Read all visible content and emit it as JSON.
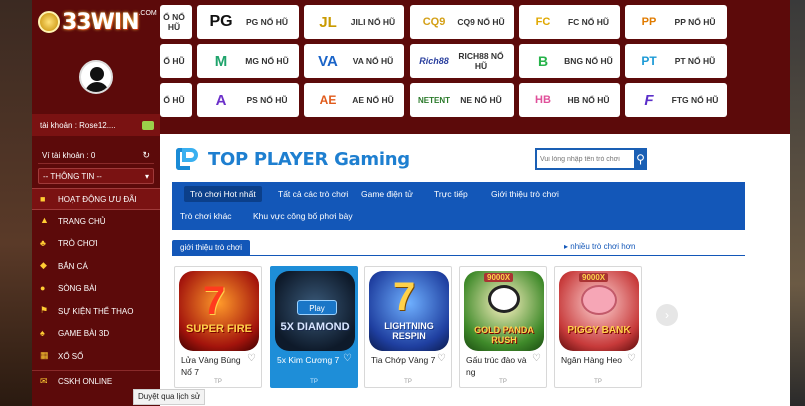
{
  "brand": {
    "logo_text": "33WIN",
    "logo_com": ".COM"
  },
  "sidebar": {
    "account_label": "tài khoản : Rose12....",
    "wallet_label": "Ví tài khoản : 0",
    "info_select": "-- THÔNG TIN --",
    "menu": [
      {
        "label": "HOẠT ĐỘNG ƯU ĐÃI",
        "icon": "gift-icon"
      },
      {
        "label": "TRANG CHỦ",
        "icon": "home-icon"
      },
      {
        "label": "TRÒ CHƠI",
        "icon": "games-icon"
      },
      {
        "label": "BẮN CÁ",
        "icon": "fish-icon"
      },
      {
        "label": "SÒNG BÀI",
        "icon": "casino-icon"
      },
      {
        "label": "SỰ KIỆN THỂ THAO",
        "icon": "sports-icon"
      },
      {
        "label": "GAME BÀI 3D",
        "icon": "cards-icon"
      },
      {
        "label": "XỔ SỐ",
        "icon": "lottery-icon"
      },
      {
        "label": "CSKH ONLINE",
        "icon": "chat-icon"
      }
    ]
  },
  "providers": [
    {
      "name": "Ổ NỔ HŨ",
      "logo": ""
    },
    {
      "name": "PG NỔ HŨ",
      "logo": "PG"
    },
    {
      "name": "JILI NỔ HŨ",
      "logo": "JL"
    },
    {
      "name": "CQ9 NỔ HŨ",
      "logo": "CQ9"
    },
    {
      "name": "FC NỔ HŨ",
      "logo": "FC"
    },
    {
      "name": "PP NỔ HŨ",
      "logo": "PP"
    },
    {
      "name": "Ổ HŨ",
      "logo": ""
    },
    {
      "name": "MG NỔ HŨ",
      "logo": "M"
    },
    {
      "name": "VA NỔ HŨ",
      "logo": "VA"
    },
    {
      "name": "RICH88 NỔ HŨ",
      "logo": "Rich88"
    },
    {
      "name": "BNG NỔ HŨ",
      "logo": "B"
    },
    {
      "name": "PT NỔ HŨ",
      "logo": "PT"
    },
    {
      "name": "Ổ HŨ",
      "logo": ""
    },
    {
      "name": "PS NỔ HŨ",
      "logo": "A"
    },
    {
      "name": "AE NỔ HŨ",
      "logo": "AE"
    },
    {
      "name": "NE NỔ HŨ",
      "logo": "NETENT"
    },
    {
      "name": "HB NỔ HŨ",
      "logo": "HB"
    },
    {
      "name": "FTG NỔ HŨ",
      "logo": "F"
    }
  ],
  "content": {
    "brand_title": "TOP PLAYER Gaming",
    "search_placeholder": "Vui lòng nhập tên trò chơi",
    "nav": [
      "Trò chơi Hot nhất",
      "Tất cả các trò chơi",
      "Game điện tử",
      "Trực tiếp",
      "Giới thiệu trò chơi",
      "Trò chơi khác",
      "Khu vực công bố phơi bày"
    ],
    "section_tab": "giới thiệu trò chơi",
    "more_link": "nhiều trò chơi hơn",
    "games": [
      {
        "name": "Lửa Vàng Bùng Nổ 7",
        "title": "SUPER FIRE",
        "tp": "TP"
      },
      {
        "name": "5x Kim Cương 7",
        "title": "5X DIAMOND",
        "tp": "TP",
        "play": "Play"
      },
      {
        "name": "Tia Chớp Vàng 7",
        "title": "LIGHTNING RESPIN",
        "tp": "TP"
      },
      {
        "name": "Gấu trúc đào và ng",
        "title": "GOLD PANDA RUSH",
        "tp": "TP",
        "badge": "9000X"
      },
      {
        "name": "Ngân Hàng Heo",
        "title": "PIGGY BANK",
        "tp": "TP",
        "badge": "9000X"
      }
    ]
  },
  "status_bar": "Duyệt qua lịch sử",
  "colors": {
    "sidebar": "#5c0a0a",
    "accent": "#1357b8",
    "brand_blue": "#1e7fd0",
    "highlight_card": "#1e8ed8"
  }
}
